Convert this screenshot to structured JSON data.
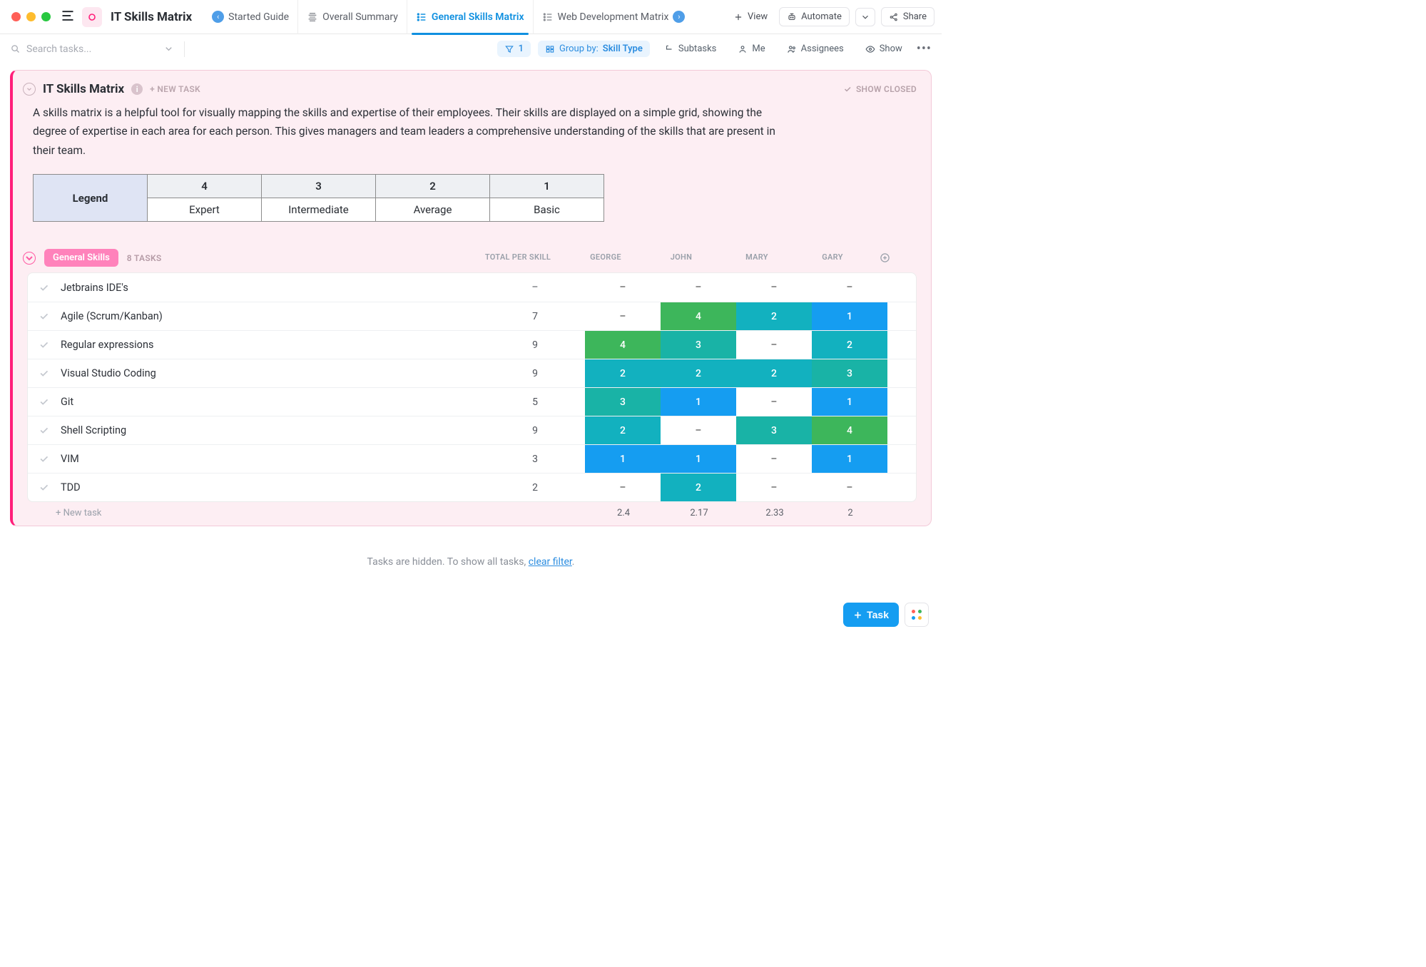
{
  "app_title": "IT Skills Matrix",
  "tabs": {
    "started": "Started Guide",
    "overall": "Overall Summary",
    "general": "General Skills Matrix",
    "webdev": "Web Development Matrix"
  },
  "topbar": {
    "view": "View",
    "automate": "Automate",
    "share": "Share"
  },
  "toolbar": {
    "search_placeholder": "Search tasks...",
    "filter_count": "1",
    "group_label": "Group by:",
    "group_value": "Skill Type",
    "subtasks": "Subtasks",
    "me": "Me",
    "assignees": "Assignees",
    "show": "Show"
  },
  "panel": {
    "title": "IT Skills Matrix",
    "new_task": "+ NEW TASK",
    "show_closed": "SHOW CLOSED",
    "description": "A skills matrix is a helpful tool for visually mapping the skills and expertise of their employees. Their skills are displayed on a simple grid, showing the degree of expertise in each area for each person. This gives managers and team leaders a comprehensive understanding of the skills that are present in their team."
  },
  "legend": {
    "header": "Legend",
    "cols": [
      {
        "num": "4",
        "label": "Expert"
      },
      {
        "num": "3",
        "label": "Intermediate"
      },
      {
        "num": "2",
        "label": "Average"
      },
      {
        "num": "1",
        "label": "Basic"
      }
    ]
  },
  "group": {
    "name": "General Skills",
    "count": "8 TASKS"
  },
  "columns": {
    "total": "TOTAL PER SKILL",
    "p1": "GEORGE",
    "p2": "JOHN",
    "p3": "MARY",
    "p4": "GARY"
  },
  "rows": [
    {
      "name": "Jetbrains IDE's",
      "total": "–",
      "v": [
        "–",
        "–",
        "–",
        "–"
      ]
    },
    {
      "name": "Agile (Scrum/Kanban)",
      "total": "7",
      "v": [
        "–",
        "4",
        "2",
        "1"
      ]
    },
    {
      "name": "Regular expressions",
      "total": "9",
      "v": [
        "4",
        "3",
        "–",
        "2"
      ]
    },
    {
      "name": "Visual Studio Coding",
      "total": "9",
      "v": [
        "2",
        "2",
        "2",
        "3"
      ]
    },
    {
      "name": "Git",
      "total": "5",
      "v": [
        "3",
        "1",
        "–",
        "1"
      ]
    },
    {
      "name": "Shell Scripting",
      "total": "9",
      "v": [
        "2",
        "–",
        "3",
        "4"
      ]
    },
    {
      "name": "VIM",
      "total": "3",
      "v": [
        "1",
        "1",
        "–",
        "1"
      ]
    },
    {
      "name": "TDD",
      "total": "2",
      "v": [
        "–",
        "2",
        "–",
        "–"
      ]
    }
  ],
  "footer": {
    "new_task": "+ New task",
    "avgs": [
      "2.4",
      "2.17",
      "2.33",
      "2"
    ]
  },
  "hidden_note": {
    "prefix": "Tasks are hidden. To show all tasks, ",
    "link": "clear filter",
    "suffix": "."
  },
  "float": {
    "task": "Task"
  }
}
